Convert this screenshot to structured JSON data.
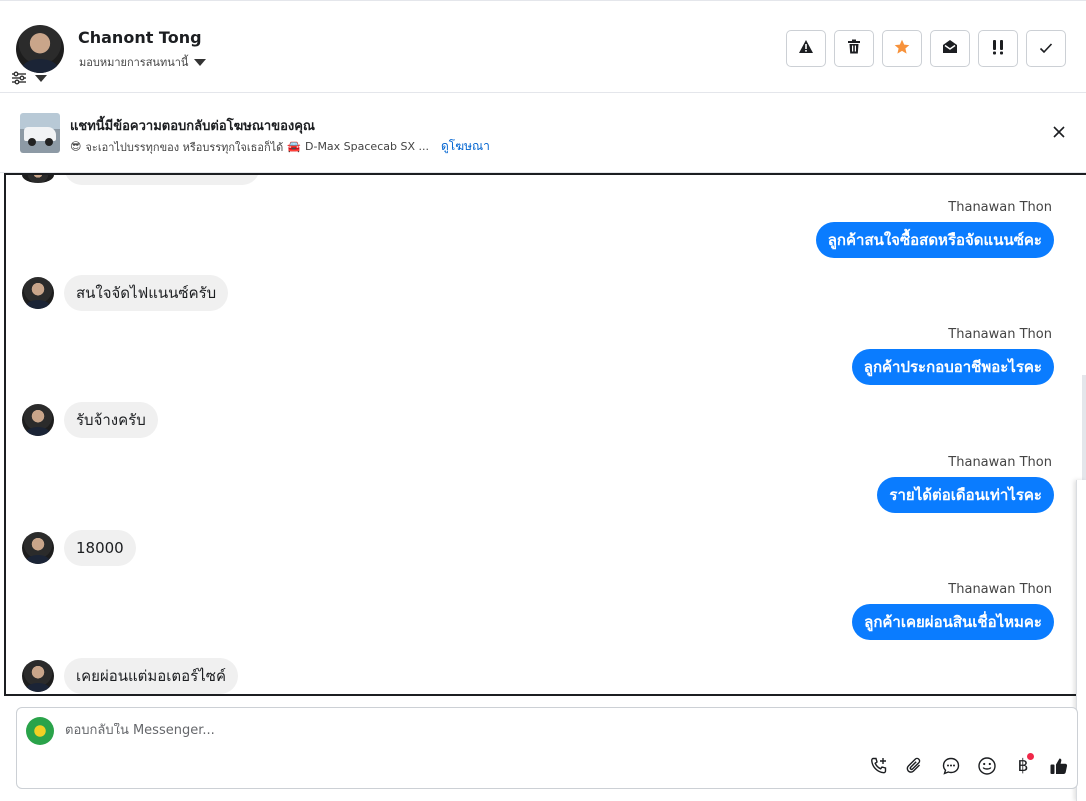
{
  "contact": {
    "name": "Chanont Tong",
    "assign_label": "มอบหมายการสนทนานี้"
  },
  "toolbar": {
    "buttons": [
      {
        "name": "report",
        "icon": "warning-icon"
      },
      {
        "name": "delete",
        "icon": "trash-icon"
      },
      {
        "name": "star",
        "icon": "star-icon",
        "color": "#f7923b"
      },
      {
        "name": "mark-unread",
        "icon": "open-envelope-icon"
      },
      {
        "name": "follow-up",
        "icon": "double-exclamation-icon"
      },
      {
        "name": "done",
        "icon": "check-icon"
      }
    ]
  },
  "ad": {
    "title": "แชทนี้มีข้อความตอบกลับต่อโฆษณาของคุณ",
    "emoji": "😎",
    "snippet": "จะเอาไปบรรทุกของ หรือบรรทุกใจเธอก็ได้",
    "car_emoji": "🚘",
    "product": "D-Max Spacecab SX ...",
    "link": "ดูโฆษณา"
  },
  "messages": [
    {
      "direction": "out",
      "sender": "Thanawan Thon",
      "text": "ลูกค้าสนใจซื้อสดหรือจัดแนนซ์คะ"
    },
    {
      "direction": "in",
      "text": "สนใจจัดไฟแนนซ์ครับ"
    },
    {
      "direction": "out",
      "sender": "Thanawan Thon",
      "text": "ลูกค้าประกอบอาชีพอะไรคะ"
    },
    {
      "direction": "in",
      "text": "รับจ้างครับ"
    },
    {
      "direction": "out",
      "sender": "Thanawan Thon",
      "text": "รายได้ต่อเดือนเท่าไรคะ"
    },
    {
      "direction": "in",
      "text": "18000"
    },
    {
      "direction": "out",
      "sender": "Thanawan Thon",
      "text": "ลูกค้าเคยผ่อนสินเชื่อไหมคะ"
    },
    {
      "direction": "in",
      "text": "เคยผ่อนแต่มอเตอร์ไซค์"
    }
  ],
  "composer": {
    "placeholder": "ตอบกลับใน Messenger...",
    "icons": [
      "call-add-icon",
      "attachment-icon",
      "saved-reply-icon",
      "emoji-icon",
      "baht-payment-icon",
      "thumbs-up-icon"
    ],
    "baht_symbol": "฿"
  },
  "colors": {
    "outgoing_bubble": "#0a7cff",
    "incoming_bubble": "#f0f0f0",
    "link": "#0064d1"
  }
}
